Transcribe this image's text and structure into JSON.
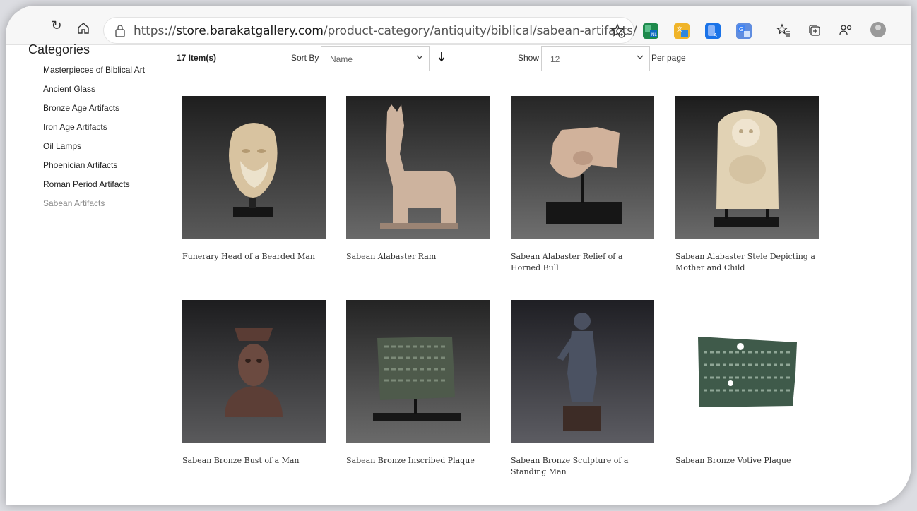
{
  "browser": {
    "url_scheme": "https://",
    "url_host": "store.barakatgallery.com",
    "url_path": "/product-category/antiquity/biblical/sabean-artifacts/"
  },
  "sidebar": {
    "heading": "Categories",
    "items": [
      {
        "label": "Masterpieces of Biblical Art"
      },
      {
        "label": "Ancient Glass"
      },
      {
        "label": "Bronze Age Artifacts"
      },
      {
        "label": "Iron Age Artifacts"
      },
      {
        "label": "Oil Lamps"
      },
      {
        "label": "Phoenician Artifacts"
      },
      {
        "label": "Roman Period Artifacts"
      },
      {
        "label": "Sabean Artifacts",
        "active": true
      }
    ]
  },
  "listing": {
    "item_count": "17 Item(s)",
    "sort_label": "Sort By",
    "sort_value": "Name",
    "sort_direction_icon": "arrow-down",
    "show_label": "Show",
    "show_value": "12",
    "per_page_label": "Per page"
  },
  "products": [
    {
      "title": "Funerary Head of a Bearded Man",
      "image": "alabaster-head"
    },
    {
      "title": "Sabean Alabaster Ram",
      "image": "alabaster-ram"
    },
    {
      "title": "Sabean Alabaster Relief of a Horned Bull",
      "image": "alabaster-bull"
    },
    {
      "title": "Sabean Alabaster Stele Depicting a Mother and Child",
      "image": "alabaster-stele"
    },
    {
      "title": "Sabean Bronze Bust of a Man",
      "image": "bronze-bust"
    },
    {
      "title": "Sabean Bronze Inscribed Plaque",
      "image": "bronze-plaque"
    },
    {
      "title": "Sabean Bronze Sculpture of a Standing Man",
      "image": "bronze-man"
    },
    {
      "title": "Sabean Bronze Votive Plaque",
      "image": "votive-plaque"
    }
  ]
}
